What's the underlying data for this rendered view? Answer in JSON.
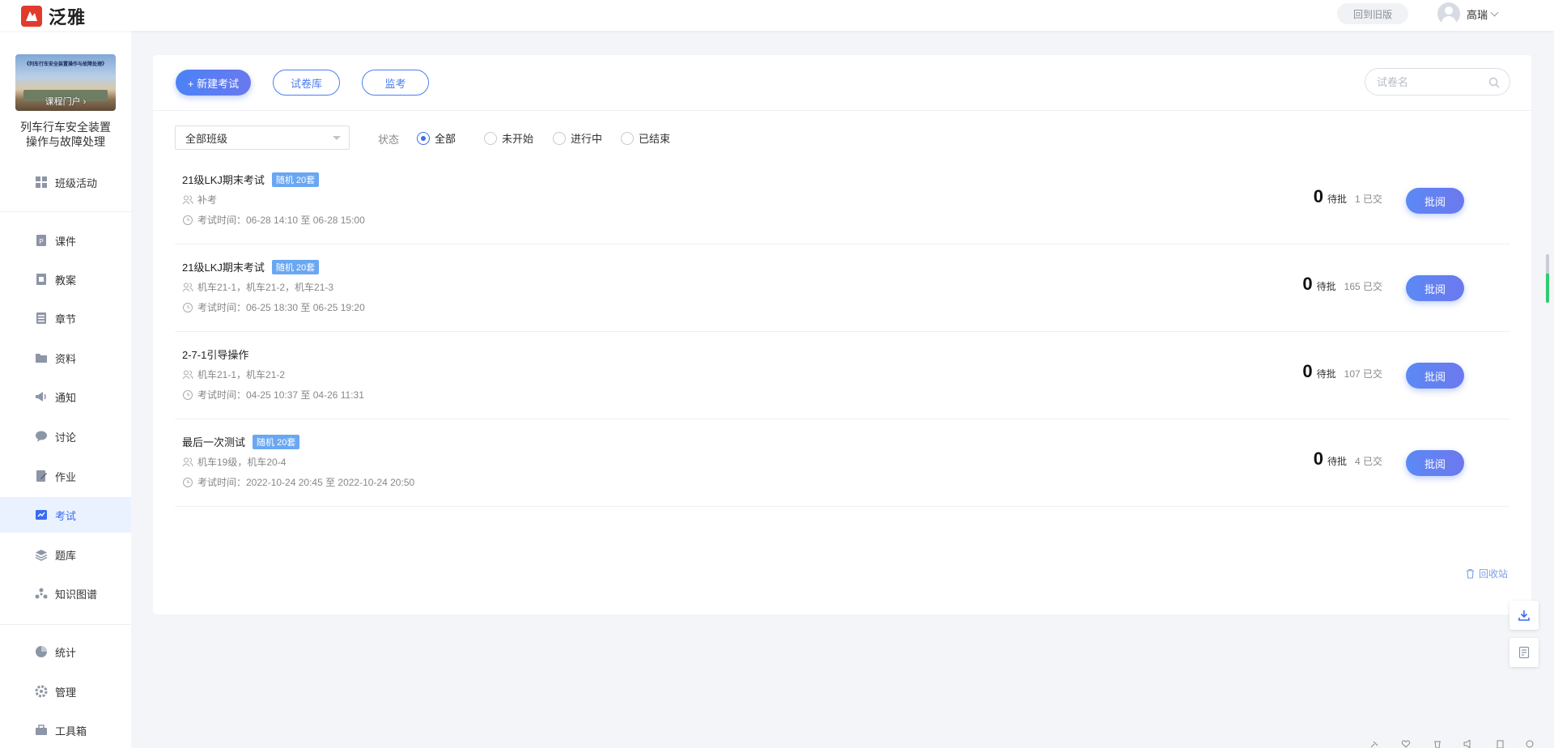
{
  "header": {
    "brand": "泛雅",
    "old_version_label": "回到旧版",
    "user_name": "高瑞"
  },
  "sidebar": {
    "cover_title": "《列车行车安全装置操作与故障处理》",
    "cover_link": "课程门户 ›",
    "course_name_line1": "列车行车安全装置",
    "course_name_line2": "操作与故障处理",
    "items": [
      {
        "label": "班级活动",
        "icon": "grid-icon"
      },
      {
        "label": "课件",
        "icon": "courseware-icon"
      },
      {
        "label": "教案",
        "icon": "lesson-plan-icon"
      },
      {
        "label": "章节",
        "icon": "chapter-icon"
      },
      {
        "label": "资料",
        "icon": "folder-icon"
      },
      {
        "label": "通知",
        "icon": "megaphone-icon"
      },
      {
        "label": "讨论",
        "icon": "chat-icon"
      },
      {
        "label": "作业",
        "icon": "homework-icon"
      },
      {
        "label": "考试",
        "icon": "exam-icon"
      },
      {
        "label": "题库",
        "icon": "question-bank-icon"
      },
      {
        "label": "知识图谱",
        "icon": "knowledge-graph-icon"
      },
      {
        "label": "统计",
        "icon": "pie-chart-icon"
      },
      {
        "label": "管理",
        "icon": "gear-icon"
      },
      {
        "label": "工具箱",
        "icon": "toolbox-icon"
      }
    ],
    "active_item": "考试"
  },
  "toolbar": {
    "new_exam": "+ 新建考试",
    "paper_bank": "试卷库",
    "proctor": "监考",
    "search_placeholder": "试卷名"
  },
  "filters": {
    "class_select": "全部班级",
    "status_label": "状态",
    "status_options": [
      "全部",
      "未开始",
      "进行中",
      "已结束"
    ],
    "selected_status": "全部"
  },
  "exams": [
    {
      "title": "21级LKJ期末考试",
      "badge": "随机 20套",
      "classes": "补考",
      "time": "考试时间：06-28 14:10 至 06-28 15:00",
      "pending": "0",
      "pending_label": "待批",
      "submitted": "1 已交",
      "action": "批阅"
    },
    {
      "title": "21级LKJ期末考试",
      "badge": "随机 20套",
      "classes": "机车21-1，机车21-2，机车21-3",
      "time": "考试时间：06-25 18:30 至 06-25 19:20",
      "pending": "0",
      "pending_label": "待批",
      "submitted": "165 已交",
      "action": "批阅"
    },
    {
      "title": "2-7-1引导操作",
      "badge": "",
      "classes": "机车21-1，机车21-2",
      "time": "考试时间：04-25 10:37 至 04-26 11:31",
      "pending": "0",
      "pending_label": "待批",
      "submitted": "107 已交",
      "action": "批阅"
    },
    {
      "title": "最后一次测试",
      "badge": "随机 20套",
      "classes": "机车19级，机车20-4",
      "time": "考试时间：2022-10-24 20:45 至 2022-10-24 20:50",
      "pending": "0",
      "pending_label": "待批",
      "submitted": "4 已交",
      "action": "批阅"
    }
  ],
  "recycle_bin": "回收站",
  "colors": {
    "accent": "#3a6cf0",
    "brand_red": "#e23b2e",
    "badge": "#6aa7f2"
  }
}
